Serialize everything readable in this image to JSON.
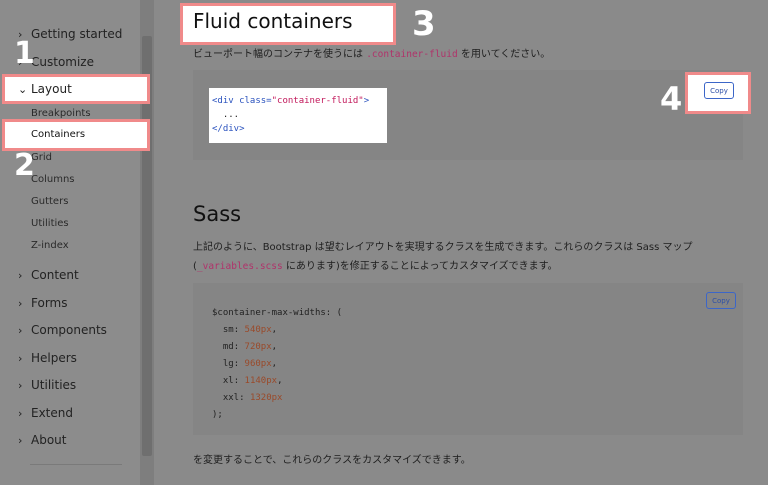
{
  "sidebar": {
    "items": [
      {
        "label": "Getting started",
        "chevron": "›"
      },
      {
        "label": "Customize",
        "chevron": "›"
      },
      {
        "label": "Layout",
        "chevron": "⌄"
      },
      {
        "label": "Content",
        "chevron": "›"
      },
      {
        "label": "Forms",
        "chevron": "›"
      },
      {
        "label": "Components",
        "chevron": "›"
      },
      {
        "label": "Helpers",
        "chevron": "›"
      },
      {
        "label": "Utilities",
        "chevron": "›"
      },
      {
        "label": "Extend",
        "chevron": "›"
      },
      {
        "label": "About",
        "chevron": "›"
      }
    ],
    "sub_items": [
      "Breakpoints",
      "Containers",
      "Grid",
      "Columns",
      "Gutters",
      "Utilities",
      "Z-index"
    ]
  },
  "main": {
    "title": "Fluid containers",
    "intro_before": "ビューポート幅のコンテナを使うには",
    "intro_code": ".container-fluid",
    "intro_after": "を用いてください。",
    "code1": {
      "line1_open": "<div ",
      "line1_attr": "class=",
      "line1_val": "\"container-fluid\"",
      "line1_close": ">",
      "line2": "  ...",
      "line3": "</div>"
    },
    "copy_label": "Copy",
    "sass_heading": "Sass",
    "sass_p1": "上記のように、Bootstrap は望むレイアウトを実現するクラスを生成できます。これらのクラスは Sass マップ",
    "sass_p2_before": "(",
    "sass_p2_code": "_variables.scss",
    "sass_p2_after": " にあります)を修正することによってカスタマイズできます。",
    "code2": {
      "line1": "$container-max-widths: (",
      "rows": [
        {
          "key": "sm",
          "num": "540",
          "unit": "px"
        },
        {
          "key": "md",
          "num": "720",
          "unit": "px"
        },
        {
          "key": "lg",
          "num": "960",
          "unit": "px"
        },
        {
          "key": "xl",
          "num": "1140",
          "unit": "px"
        },
        {
          "key": "xxl",
          "num": "1320",
          "unit": "px"
        }
      ],
      "close": ");"
    },
    "outro": "を変更することで、これらのクラスをカスタマイズできます。"
  },
  "annotations": [
    "1",
    "2",
    "3",
    "4"
  ],
  "colors": {
    "overlay": "#8a8a8a",
    "highlight_border": "#f08a8a",
    "code_blue": "#2a52be",
    "code_string": "#c2185b",
    "code_number": "#9a4a2a",
    "inline_code": "#b0336a"
  }
}
